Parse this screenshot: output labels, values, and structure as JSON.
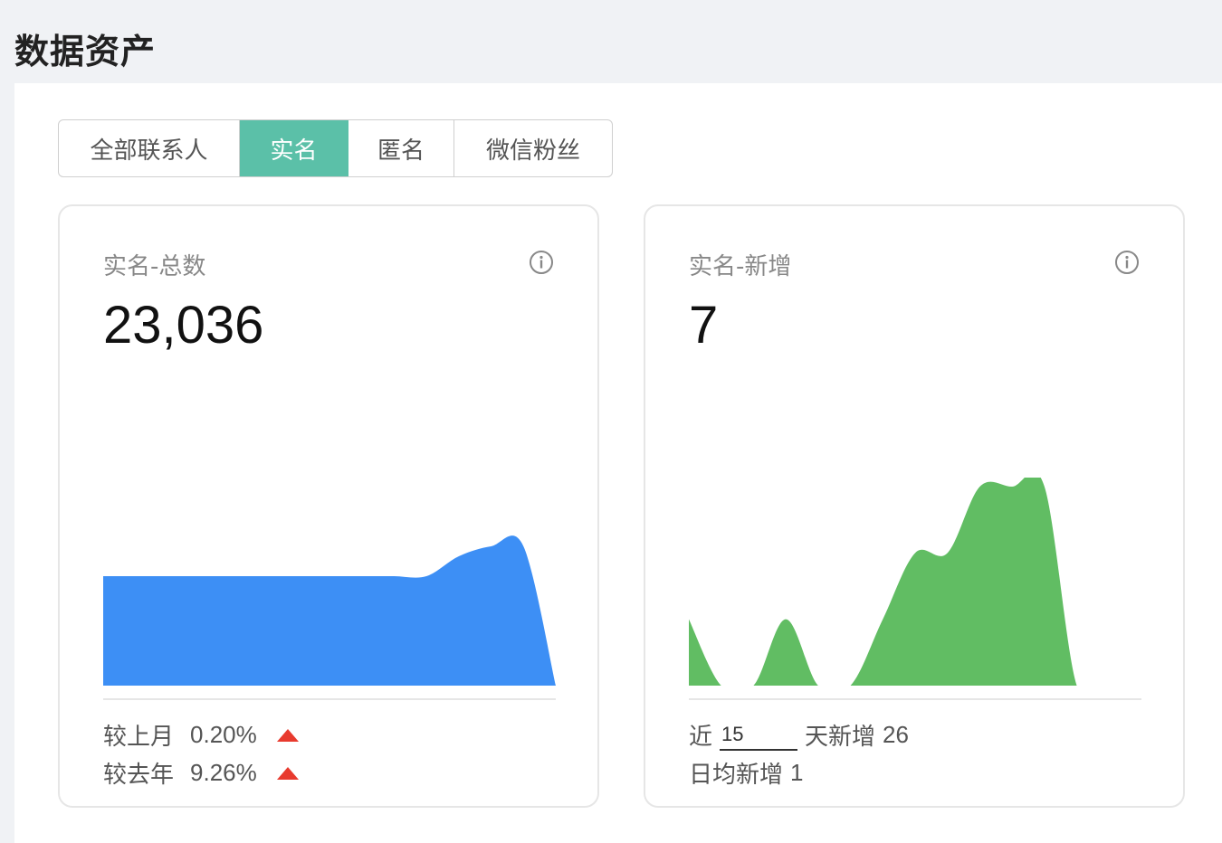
{
  "page": {
    "title": "数据资产"
  },
  "tabs": [
    {
      "label": "全部联系人",
      "active": false
    },
    {
      "label": "实名",
      "active": true
    },
    {
      "label": "匿名",
      "active": false
    },
    {
      "label": "微信粉丝",
      "active": false
    }
  ],
  "colors": {
    "accent": "#5bc0a8",
    "total_chart": "#3d8ff5",
    "new_chart": "#61bd63",
    "up_arrow": "#e83a2e"
  },
  "total_card": {
    "title": "实名-总数",
    "value": "23,036",
    "mom_label": "较上月",
    "mom_value": "0.20%",
    "yoy_label": "较去年",
    "yoy_value": "9.26%",
    "icon": "info-icon"
  },
  "new_card": {
    "title": "实名-新增",
    "value": "7",
    "recent_prefix": "近",
    "recent_days": "15",
    "recent_suffix": "天新增",
    "recent_count": "26",
    "daily_label": "日均新增",
    "daily_value": "1",
    "icon": "info-icon"
  },
  "chart_data": [
    {
      "type": "area",
      "x": [
        1,
        2,
        3,
        4,
        5,
        6,
        7,
        8,
        9,
        10,
        11,
        12,
        13,
        14,
        15
      ],
      "values": [
        23001,
        23001,
        23001,
        23001,
        23001,
        23001,
        23001,
        23001,
        23001,
        23001,
        23001,
        23003,
        23004,
        23004,
        22990
      ],
      "ylim": [
        22990,
        23010
      ]
    },
    {
      "type": "area",
      "x": [
        1,
        2,
        3,
        4,
        5,
        6,
        7,
        8,
        9,
        10,
        11,
        12,
        13,
        14,
        15
      ],
      "values": [
        1,
        0,
        0,
        1,
        0,
        0,
        1,
        2,
        2,
        3,
        3,
        3,
        0,
        0,
        0
      ],
      "ylim": [
        0,
        3
      ]
    }
  ]
}
